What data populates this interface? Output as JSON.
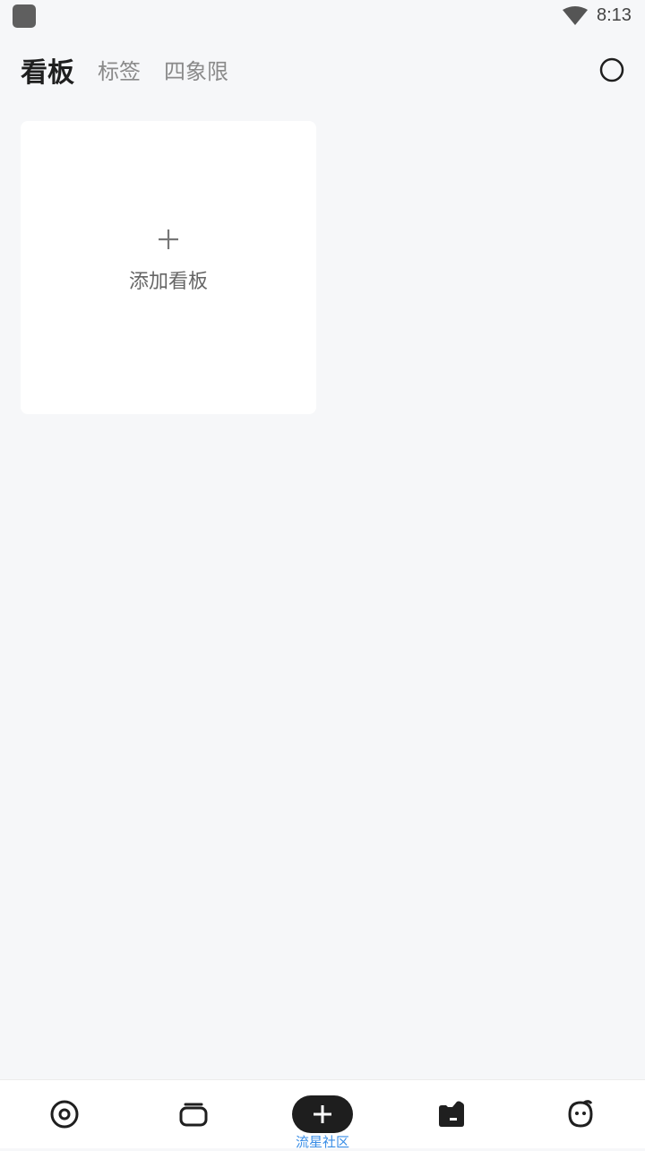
{
  "status_bar": {
    "time": "8:13",
    "icons": [
      "app-badge",
      "wifi-icon"
    ]
  },
  "header": {
    "tabs": [
      {
        "label": "看板",
        "active": true
      },
      {
        "label": "标签",
        "active": false
      },
      {
        "label": "四象限",
        "active": false
      }
    ],
    "right_icon": "circle-icon"
  },
  "board_grid": {
    "add_card": {
      "icon": "plus-icon",
      "label": "添加看板"
    }
  },
  "bottom_nav": {
    "items": [
      {
        "icon": "focus-target-icon"
      },
      {
        "icon": "stack-cards-icon"
      },
      {
        "icon": "add-plus-icon"
      },
      {
        "icon": "folder-icon"
      },
      {
        "icon": "face-icon"
      }
    ],
    "community_label": "流星社区"
  },
  "colors": {
    "background": "#f6f7f9",
    "card": "#ffffff",
    "active_tab": "#1f1f1f",
    "inactive_tab": "#8a8a8a",
    "fab": "#1e1e1e",
    "link_blue": "#3a8ee6"
  }
}
